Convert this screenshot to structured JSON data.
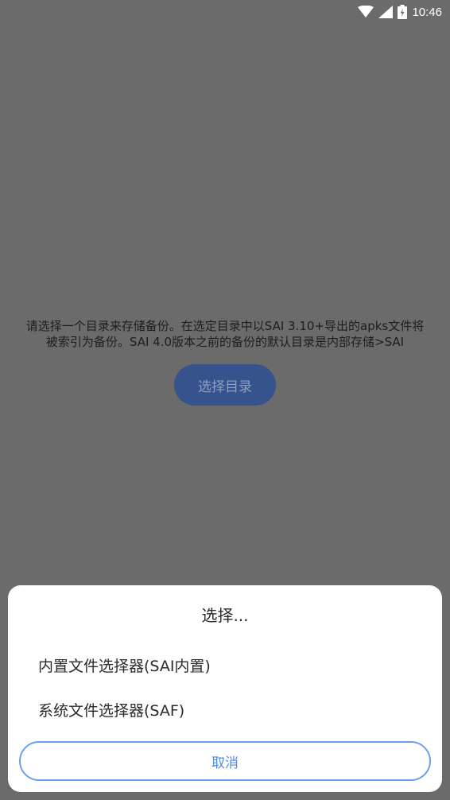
{
  "status_bar": {
    "time": "10:46",
    "icons": [
      "wifi-icon",
      "signal-icon",
      "battery-icon"
    ]
  },
  "background": {
    "message_line1": "请选择一个目录来存储备份。在选定目录中以SAI 3.10+导出的apks文件将",
    "message_line2": "被索引为备份。SAI 4.0版本之前的备份的默认目录是内部存储>SAI",
    "select_dir_button": "选择目录"
  },
  "dialog": {
    "title": "选择...",
    "options": [
      "内置文件选择器(SAI内置)",
      "系统文件选择器(SAF)"
    ],
    "cancel_label": "取消"
  },
  "colors": {
    "scrim": "#6b6b6b",
    "primary_button": "#36538e",
    "accent": "#4d8ee0",
    "sheet_bg": "#ffffff"
  }
}
